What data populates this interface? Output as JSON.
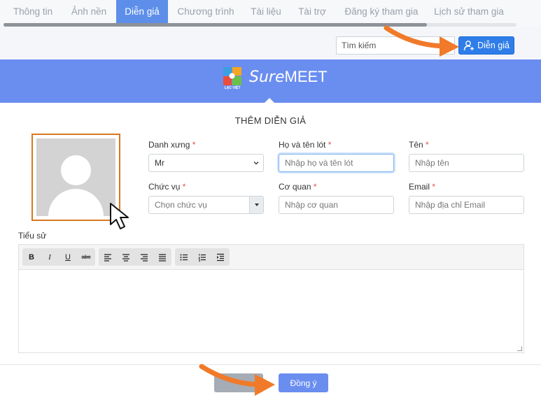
{
  "tabs": [
    {
      "label": "Thông tin",
      "active": false
    },
    {
      "label": "Ảnh nền",
      "active": false
    },
    {
      "label": "Diễn giả",
      "active": true
    },
    {
      "label": "Chương trình",
      "active": false
    },
    {
      "label": "Tài liệu",
      "active": false
    },
    {
      "label": "Tài trợ",
      "active": false
    },
    {
      "label": "Đăng ký tham gia",
      "active": false
    },
    {
      "label": "Lịch sử tham gia",
      "active": false
    }
  ],
  "toolbar": {
    "search_placeholder": "Tìm kiếm",
    "add_speaker_label": "Diễn giả"
  },
  "brand": {
    "logo_tag": "LẠC VIỆT",
    "name_italic": "Sure",
    "name_rest": "MEET"
  },
  "form": {
    "title": "THÊM DIỄN GIẢ",
    "title_field": {
      "label": "Danh xưng",
      "required": "*",
      "value": "Mr"
    },
    "last_name": {
      "label": "Họ và tên lót",
      "required": "*",
      "placeholder": "Nhập họ và tên lót"
    },
    "first_name": {
      "label": "Tên",
      "required": "*",
      "placeholder": "Nhập tên"
    },
    "position": {
      "label": "Chức vụ",
      "required": "*",
      "placeholder": "Chọn chức vụ"
    },
    "organization": {
      "label": "Cơ quan",
      "required": "*",
      "placeholder": "Nhập cơ quan"
    },
    "email": {
      "label": "Email",
      "required": "*",
      "placeholder": "Nhập địa chỉ Email"
    },
    "bio": {
      "label": "Tiểu sử"
    }
  },
  "editor_toolbar": {
    "bold": "B",
    "italic": "I",
    "underline": "U",
    "strikethrough": "abc"
  },
  "footer": {
    "agree_label": "Đồng ý"
  },
  "colors": {
    "accent": "#6a8df0",
    "active_tab": "#5d8ee9",
    "primary_button": "#2f7de8",
    "highlight_arrow": "#f07a2a",
    "avatar_border": "#d6781f"
  }
}
